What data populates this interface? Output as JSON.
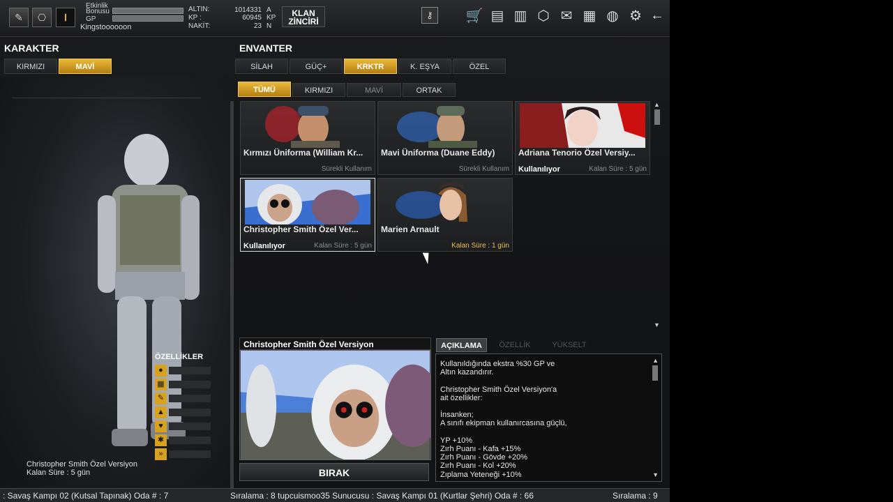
{
  "topbar": {
    "stats": [
      {
        "label": "Etkinlik"
      },
      {
        "label": "Bonusu",
        "fill": 0.0
      },
      {
        "label": "GP",
        "fill": 0.0
      }
    ],
    "nickname": "Kingstoooooon",
    "money": [
      {
        "label": "ALTIN:",
        "value": "1014331",
        "unit": "A"
      },
      {
        "label": "KP :",
        "value": "60945",
        "unit": "KP"
      },
      {
        "label": "NAKİT:",
        "value": "23",
        "unit": "N"
      }
    ],
    "clan_button": [
      "KLAN",
      "ZİNCİRİ"
    ],
    "icons": {
      "memo": "✎",
      "badge": "⎔",
      "rank": "Ⅰ",
      "key": "⚷",
      "cart": "🛒",
      "bag": "▤",
      "book": "▥",
      "box": "⬡",
      "mail": "✉",
      "folder": "▦",
      "globe": "◍",
      "gear": "⚙",
      "back": "←"
    }
  },
  "character": {
    "title": "KARAKTER",
    "tabs": [
      "KIRMIZI",
      "MAVİ"
    ],
    "name": "Christopher Smith Özel Versiyon",
    "time": "Kalan Süre : 5 gün",
    "features_title": "ÖZELLİKLER",
    "feature_icons": [
      "●",
      "▦",
      "✎",
      "▲",
      "♥",
      "✱",
      "»"
    ]
  },
  "inventory": {
    "title": "ENVANTER",
    "tabs": [
      "SİLAH",
      "GÜÇ+",
      "KRKTR",
      "K. EŞYA",
      "ÖZEL"
    ],
    "subtabs": [
      "TÜMÜ",
      "KIRMIZI",
      "MAVİ",
      "ORTAK"
    ],
    "items": [
      {
        "name": "Kırmızı Üniforma (William Kr...",
        "status": "",
        "duration": "Sürekli Kullanım"
      },
      {
        "name": "Mavi Üniforma (Duane Eddy)",
        "status": "",
        "duration": "Sürekli Kullanım"
      },
      {
        "name": "Adriana Tenorio Özel Versiy...",
        "status": "Kullanılıyor",
        "duration": "Kalan Süre : 5 gün"
      },
      {
        "name": "Christopher Smith Özel Ver...",
        "status": "Kullanılıyor",
        "duration": "Kalan Süre : 5 gün"
      },
      {
        "name": "Marien Arnault",
        "status": "",
        "duration": "Kalan Süre : 1 gün"
      }
    ]
  },
  "detail": {
    "title": "Christopher Smith Özel Versiyon",
    "drop_label": "BIRAK",
    "tabs": [
      "AÇIKLAMA",
      "ÖZELLİK",
      "YÜKSELT"
    ],
    "lines": [
      "Kullanıldığında ekstra %30 GP ve",
      "Altın kazandırır.",
      "",
      "Christopher Smith Özel Versiyon'a",
      "ait özellikler:",
      "",
      "İnsanken;",
      "A sınıfı ekipman kullanırcasına güçlü,",
      "",
      "YP +10%",
      "Zırh Puanı - Kafa +15%",
      "Zırh Puanı - Gövde +20%",
      "Zırh Puanı - Kol +20%",
      "Zıplama Yeteneği +10%"
    ]
  },
  "ticker": {
    "left": ": Savaş Kampı 02 (Kutsal Tapınak) Oda # : 7",
    "middle": "Sıralama : 8 tupcuismoo35 Sunucusu : Savaş Kampı 01 (Kurtlar Şehri) Oda # : 66",
    "right": "Sıralama : 9"
  },
  "colors": {
    "accent": "#d9a21c",
    "panel": "#1d1e20"
  }
}
